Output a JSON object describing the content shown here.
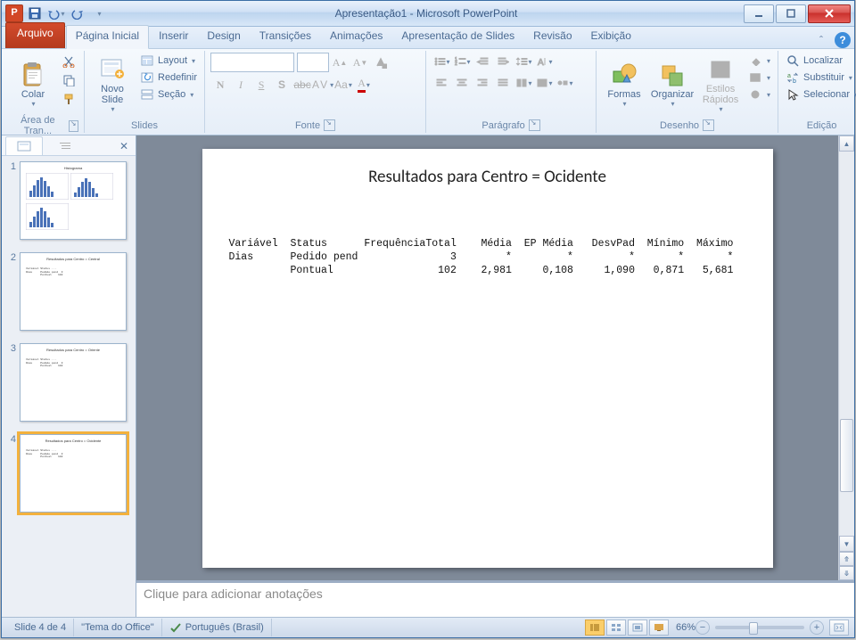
{
  "app": {
    "title": "Apresentação1 - Microsoft PowerPoint",
    "qat": {
      "appLetter": "P"
    }
  },
  "tabs": {
    "file": "Arquivo",
    "items": [
      "Página Inicial",
      "Inserir",
      "Design",
      "Transições",
      "Animações",
      "Apresentação de Slides",
      "Revisão",
      "Exibição"
    ],
    "activeIndex": 0
  },
  "ribbon": {
    "clipboard": {
      "paste": "Colar",
      "label": "Área de Tran..."
    },
    "slides": {
      "newslide": "Novo Slide",
      "layout": "Layout",
      "reset": "Redefinir",
      "section": "Seção",
      "label": "Slides"
    },
    "font": {
      "label": "Fonte"
    },
    "paragraph": {
      "label": "Parágrafo"
    },
    "drawing": {
      "shapes": "Formas",
      "arrange": "Organizar",
      "styles": "Estilos Rápidos",
      "label": "Desenho"
    },
    "editing": {
      "find": "Localizar",
      "replace": "Substituir",
      "select": "Selecionar",
      "label": "Edição"
    }
  },
  "slide": {
    "title": "Resultados para Centro = Ocidente",
    "headers": [
      "Variável",
      "Status",
      "FrequênciaTotal",
      "Média",
      "EP Média",
      "DesvPad",
      "Mínimo",
      "Máximo"
    ],
    "rows": [
      {
        "variavel": "Dias",
        "status": "Pedido pend",
        "freq": "3",
        "media": "*",
        "ep": "*",
        "desv": "*",
        "min": "*",
        "max": "*"
      },
      {
        "variavel": "",
        "status": "Pontual",
        "freq": "102",
        "media": "2,981",
        "ep": "0,108",
        "desv": "1,090",
        "min": "0,871",
        "max": "5,681"
      }
    ]
  },
  "thumbs": {
    "count": 4,
    "selected": 4,
    "titles": [
      "",
      "Resultados para Centro = Central",
      "Resultados para Centro = Oriente",
      "Resultados para Centro = Ocidente"
    ]
  },
  "notes": {
    "placeholder": "Clique para adicionar anotações"
  },
  "status": {
    "slide": "Slide 4 de 4",
    "theme": "\"Tema do Office\"",
    "lang": "Português (Brasil)",
    "zoom": "66%"
  }
}
